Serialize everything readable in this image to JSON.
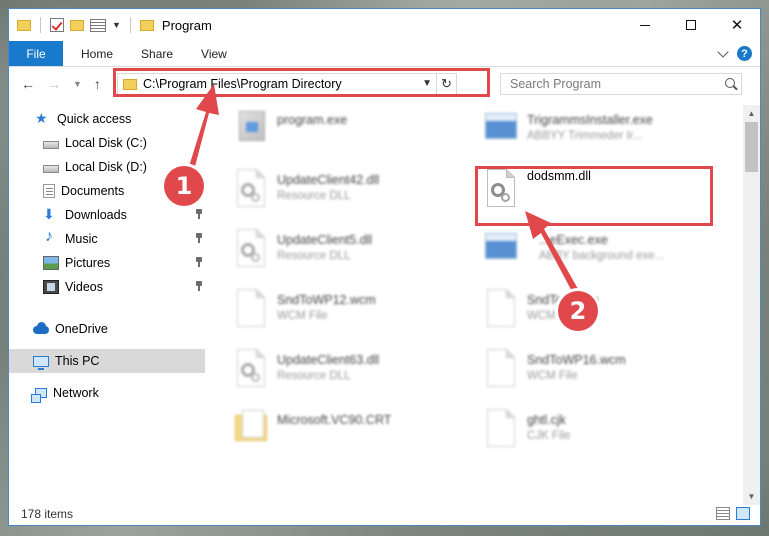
{
  "window": {
    "title": "Program"
  },
  "ribbon": {
    "tabs": [
      "File",
      "Home",
      "Share",
      "View"
    ],
    "help_label": "?"
  },
  "address_bar": {
    "path": "C:\\Program Files\\Program Directory"
  },
  "search": {
    "placeholder": "Search Program"
  },
  "sidebar": {
    "items": [
      {
        "label": "Quick access",
        "icon": "star-icon",
        "pinned": false
      },
      {
        "label": "Local Disk (C:)",
        "icon": "disk-icon",
        "pinned": false
      },
      {
        "label": "Local Disk (D:)",
        "icon": "disk-icon",
        "pinned": false
      },
      {
        "label": "Documents",
        "icon": "documents-icon",
        "pinned": false
      },
      {
        "label": "Downloads",
        "icon": "download-icon",
        "pinned": true
      },
      {
        "label": "Music",
        "icon": "music-icon",
        "pinned": true
      },
      {
        "label": "Pictures",
        "icon": "pictures-icon",
        "pinned": true
      },
      {
        "label": "Videos",
        "icon": "videos-icon",
        "pinned": true
      },
      {
        "label": "OneDrive",
        "icon": "onedrive-icon",
        "pinned": false
      },
      {
        "label": "This PC",
        "icon": "pc-icon",
        "pinned": false,
        "selected": true
      },
      {
        "label": "Network",
        "icon": "network-icon",
        "pinned": false
      }
    ]
  },
  "files": [
    {
      "name": "program.exe",
      "type": "",
      "icon": "app-icon",
      "blurred": true
    },
    {
      "name": "TrigrammsInstaller.exe",
      "type": "ABBYY Trimmeder Ir...",
      "icon": "exe-icon",
      "blurred": true
    },
    {
      "name": "UpdateClient42.dll",
      "type": "Resource DLL",
      "icon": "dll-icon",
      "blurred": true
    },
    {
      "name": "dodsmm.dll",
      "type": "",
      "icon": "dll-icon",
      "blurred": false
    },
    {
      "name": "UpdateClient5.dll",
      "type": "Resource DLL",
      "icon": "dll-icon",
      "blurred": true
    },
    {
      "name": "...eExec.exe",
      "type": "ABBY background exe...",
      "icon": "exe-icon",
      "blurred": true
    },
    {
      "name": "SndToWP12.wcm",
      "type": "WCM File",
      "icon": "page-icon",
      "blurred": true
    },
    {
      "name": "SndTo...wcm",
      "type": "WCM File",
      "icon": "page-icon",
      "blurred": true
    },
    {
      "name": "UpdateClient63.dll",
      "type": "Resource DLL",
      "icon": "dll-icon",
      "blurred": true
    },
    {
      "name": "SndToWP16.wcm",
      "type": "WCM File",
      "icon": "page-icon",
      "blurred": true
    },
    {
      "name": "Microsoft.VC90.CRT",
      "type": "",
      "icon": "folder-icon",
      "blurred": true
    },
    {
      "name": "ghtl.cjk",
      "type": "CJK File",
      "icon": "page-icon",
      "blurred": true
    }
  ],
  "status_bar": {
    "item_count": "178 items"
  },
  "callouts": {
    "step1": "1",
    "step2": "2"
  },
  "colors": {
    "accent": "#1979ca",
    "highlight": "#e0484b"
  }
}
